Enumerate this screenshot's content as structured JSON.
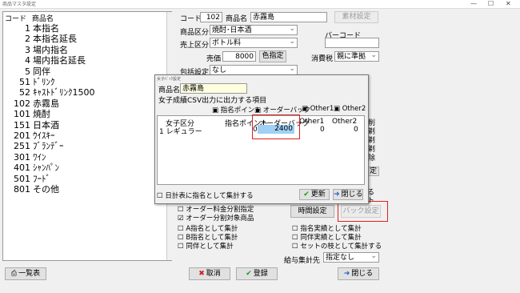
{
  "window": {
    "title": "商品マスタ設定",
    "minimize": "—",
    "maximize": "☐",
    "close": "✕"
  },
  "list": {
    "header_code": "コード",
    "header_name": "商品名",
    "items": [
      {
        "code": "1",
        "name": "本指名"
      },
      {
        "code": "2",
        "name": "本指名延長"
      },
      {
        "code": "3",
        "name": "場内指名"
      },
      {
        "code": "4",
        "name": "場内指名延長"
      },
      {
        "code": "5",
        "name": "同伴"
      },
      {
        "code": "51",
        "name": "ﾄﾞﾘﾝｸ"
      },
      {
        "code": "52",
        "name": "ｷｬｽﾄﾄﾞﾘﾝｸ1500"
      },
      {
        "code": "102",
        "name": "赤霧島"
      },
      {
        "code": "101",
        "name": "焼酎"
      },
      {
        "code": "151",
        "name": "日本酒"
      },
      {
        "code": "201",
        "name": "ｳｲｽｷｰ"
      },
      {
        "code": "251",
        "name": "ﾌﾞﾗﾝﾃﾞｰ"
      },
      {
        "code": "301",
        "name": "ﾜｲﾝ"
      },
      {
        "code": "401",
        "name": "ｼｬﾝﾊﾟﾝ"
      },
      {
        "code": "501",
        "name": "ﾌｰﾄﾞ"
      },
      {
        "code": "801",
        "name": "その他"
      }
    ]
  },
  "form": {
    "code_label": "コード",
    "code_value": "102",
    "name_label": "商品名",
    "name_value": "赤霧島",
    "material_button": "素材設定",
    "category_label": "商品区分",
    "category_value": "焼酎･日本酒",
    "sales_label": "売上区分",
    "sales_value": "ボトル料",
    "barcode_label": "バーコード",
    "barcode_value": "",
    "price_label": "売価",
    "price_value": "8000",
    "color_button": "色指定",
    "tax_label": "消費税",
    "tax_value": "親に準拠",
    "package_label": "包括設定",
    "package_value": "なし"
  },
  "right_partial": [
    "削",
    "剃",
    "剃",
    "剃",
    "除",
    "定"
  ],
  "bottom_options": {
    "order_amount_split": "オーダー料金分割指定",
    "order_split_target": "オーダー分割対象商品",
    "count_a": "A指名として集計",
    "count_b": "B指名として集計",
    "count_dohan": "同伴として集計",
    "count_nomination": "指名実績として集計",
    "count_dohan_result": "同伴実績として集計",
    "count_set": "セットの枝として集計する",
    "time_button": "時間設定",
    "back_button": "バック設定",
    "payroll_label": "給与集計先",
    "payroll_value": "指定なし",
    "right_frag1": "る",
    "right_frag2": "ト"
  },
  "dialog": {
    "title": "女子ﾊﾞｯｸ設定",
    "name_label": "商品名",
    "name_value": "赤霧島",
    "csv_label": "女子成績CSV出力に出力する項目",
    "chk_nomination": "指名ポイント",
    "chk_orderback": "オーダーバック",
    "chk_other1": "Other1",
    "chk_other2": "Other2",
    "col_kubun": "女子区分",
    "col_point": "指名ポイント",
    "col_orderback": "オーダーバック",
    "col_other1": "Other1",
    "col_other2": "Other2",
    "row_kubun": "1 レギュラー",
    "row_point": "0",
    "row_orderback": "2400",
    "row_other1": "0",
    "row_other2": "0",
    "daily_check": "日計表に指名として集計する",
    "update_button": "更新",
    "close_button": "閉じる"
  },
  "footer": {
    "list_button": "一覧表",
    "cancel_button": "取消",
    "register_button": "登録",
    "close_button": "閉じる"
  }
}
